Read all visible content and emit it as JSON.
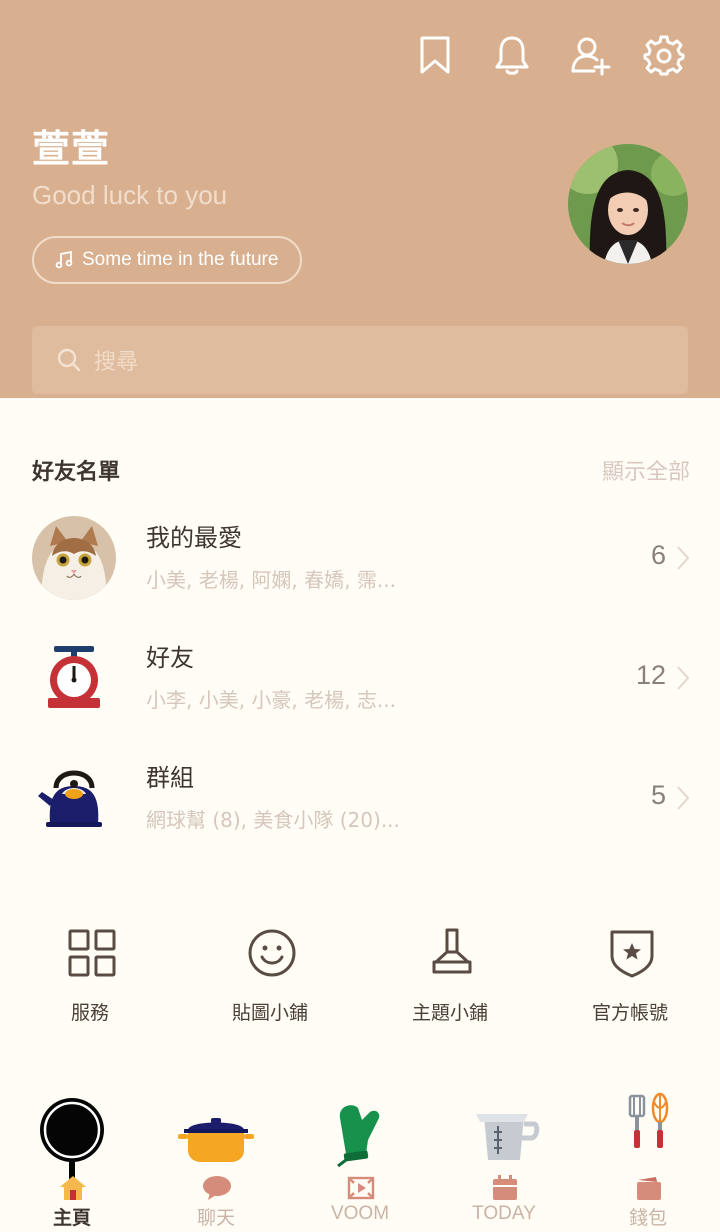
{
  "profile": {
    "name": "萱萱",
    "status_message": "Good luck to you",
    "music": "Some time in the future"
  },
  "search": {
    "placeholder": "搜尋"
  },
  "friends": {
    "title": "好友名單",
    "show_all": "顯示全部",
    "items": [
      {
        "title": "我的最愛",
        "subtitle": "小美, 老楊, 阿嫻, 春嬌, 霈...",
        "count": "6"
      },
      {
        "title": "好友",
        "subtitle": "小李, 小美, 小豪, 老楊, 志...",
        "count": "12"
      },
      {
        "title": "群組",
        "subtitle": "網球幫 (8), 美食小隊 (20)...",
        "count": "5"
      }
    ]
  },
  "shortcuts": [
    {
      "label": "服務",
      "icon": "grid-icon"
    },
    {
      "label": "貼圖小鋪",
      "icon": "smiley-icon"
    },
    {
      "label": "主題小鋪",
      "icon": "brush-icon"
    },
    {
      "label": "官方帳號",
      "icon": "shield-star-icon"
    }
  ],
  "bottom_nav": [
    {
      "label": "主頁",
      "icon": "home-icon",
      "active": true
    },
    {
      "label": "聊天",
      "icon": "chat-icon"
    },
    {
      "label": "VOOM",
      "icon": "voom-icon"
    },
    {
      "label": "TODAY",
      "icon": "calendar-icon"
    },
    {
      "label": "錢包",
      "icon": "wallet-icon"
    }
  ],
  "colors": {
    "header_bg": "#d9b08f",
    "page_bg": "#fffdf6",
    "text_dark": "#3e3530",
    "text_muted": "#d6c6bc",
    "tab_inactive": "#c9b4a6",
    "tab_icon": "#d68c7a"
  }
}
